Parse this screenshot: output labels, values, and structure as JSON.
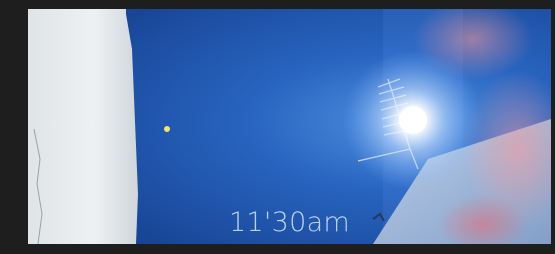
{
  "photo": {
    "caption": "11'30am",
    "sky_color": "#1b4fa0",
    "sun_color": "#ffffff",
    "wall_color": "#e8ecee"
  }
}
